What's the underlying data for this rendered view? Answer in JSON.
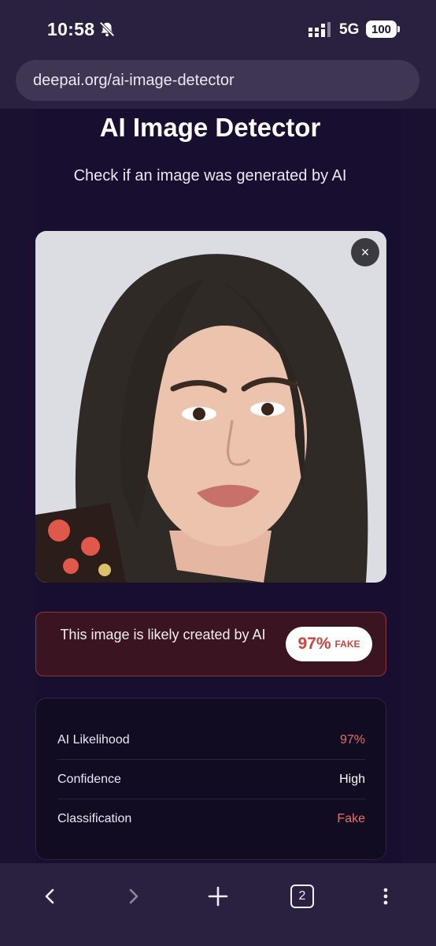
{
  "status_bar": {
    "time": "10:58",
    "network": "5G",
    "battery": "100",
    "icons": [
      "bell-off-icon",
      "signal-icon"
    ]
  },
  "browser": {
    "url": "deepai.org/ai-image-detector",
    "tab_count": "2",
    "icons": [
      "back-arrow-icon",
      "forward-arrow-icon",
      "new-tab-plus-icon",
      "more-vert-icon"
    ]
  },
  "page": {
    "title": "AI Image Detector",
    "subtitle": "Check if an image was generated by AI",
    "remove_label": "×"
  },
  "result": {
    "message": "This image is likely created by AI",
    "score": "97%",
    "verdict": "FAKE"
  },
  "details": [
    {
      "label": "AI Likelihood",
      "value": "97%",
      "status": "alert"
    },
    {
      "label": "Confidence",
      "value": "High",
      "status": "normal"
    },
    {
      "label": "Classification",
      "value": "Fake",
      "status": "alert"
    }
  ],
  "colors": {
    "background": "#1a1131",
    "alert": "#e0706a",
    "banner": "#3a1420",
    "pill_text": "#c7453e"
  }
}
